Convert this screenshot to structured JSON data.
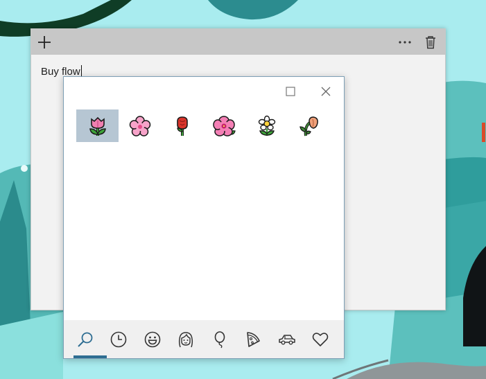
{
  "note": {
    "text": "Buy flow",
    "buttons": [
      "add-icon",
      "more-icon",
      "trash-icon"
    ]
  },
  "emoji_panel": {
    "results": [
      {
        "name": "tulip",
        "selected": true
      },
      {
        "name": "cherry-blossom",
        "selected": false
      },
      {
        "name": "rose",
        "selected": false
      },
      {
        "name": "hibiscus",
        "selected": false
      },
      {
        "name": "blossom",
        "selected": false
      },
      {
        "name": "wilted-flower",
        "selected": false
      }
    ],
    "tabs": [
      {
        "icon": "search-icon",
        "active": true
      },
      {
        "icon": "clock-icon",
        "active": false
      },
      {
        "icon": "smiley-icon",
        "active": false
      },
      {
        "icon": "person-icon",
        "active": false
      },
      {
        "icon": "balloon-icon",
        "active": false
      },
      {
        "icon": "pizza-icon",
        "active": false
      },
      {
        "icon": "car-icon",
        "active": false
      },
      {
        "icon": "heart-icon",
        "active": false
      }
    ]
  },
  "colors": {
    "accent": "#2e6d92",
    "selection": "#b6c6d3",
    "titlebar": "#c7c7c7"
  }
}
